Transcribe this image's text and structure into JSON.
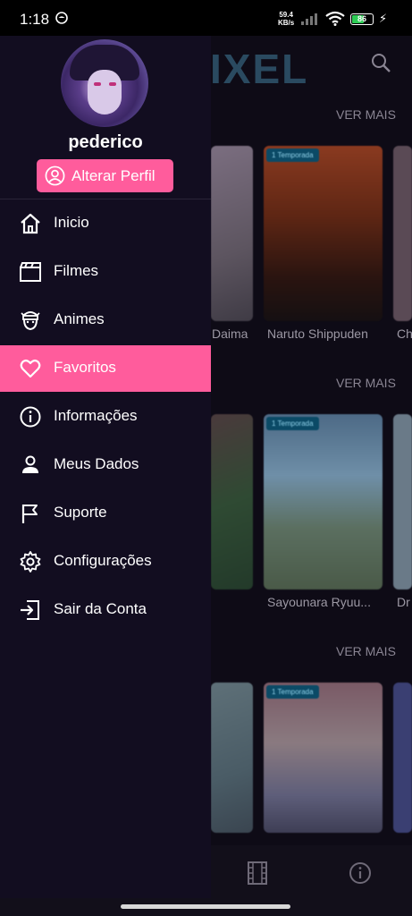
{
  "status_bar": {
    "time": "1:18",
    "net_speed": "59.4",
    "net_unit": "KB/s",
    "battery": "86"
  },
  "background": {
    "brand": "IXEL",
    "sections": [
      {
        "ver_mais": "VER MAIS"
      },
      {
        "ver_mais": "VER MAIS"
      },
      {
        "ver_mais": "VER MAIS"
      }
    ],
    "cards": [
      {
        "badge": "1 Temporada",
        "title": "Naruto Shippuden"
      },
      {
        "badge": "1 Temporada",
        "title": "Sayounara Ryuu..."
      },
      {
        "badge": "1 Temporada",
        "title": ""
      }
    ],
    "partial_titles": [
      "Daima",
      "Ch",
      "Dr"
    ]
  },
  "drawer": {
    "username": "pederico",
    "edit_profile": "Alterar Perfil",
    "active_item": "Favoritos",
    "items": [
      {
        "label": "Inicio",
        "icon": "home-icon"
      },
      {
        "label": "Filmes",
        "icon": "clapperboard-icon"
      },
      {
        "label": "Animes",
        "icon": "ninja-icon"
      },
      {
        "label": "Favoritos",
        "icon": "heart-icon"
      },
      {
        "label": "Informações",
        "icon": "info-icon"
      },
      {
        "label": "Meus Dados",
        "icon": "user-icon"
      },
      {
        "label": "Suporte",
        "icon": "flag-icon"
      },
      {
        "label": "Configurações",
        "icon": "gear-icon"
      },
      {
        "label": "Sair da Conta",
        "icon": "logout-icon"
      }
    ]
  },
  "colors": {
    "accent": "#ff5c9c",
    "drawer_bg": "#120d20",
    "badge_bg": "#0b4a66"
  }
}
